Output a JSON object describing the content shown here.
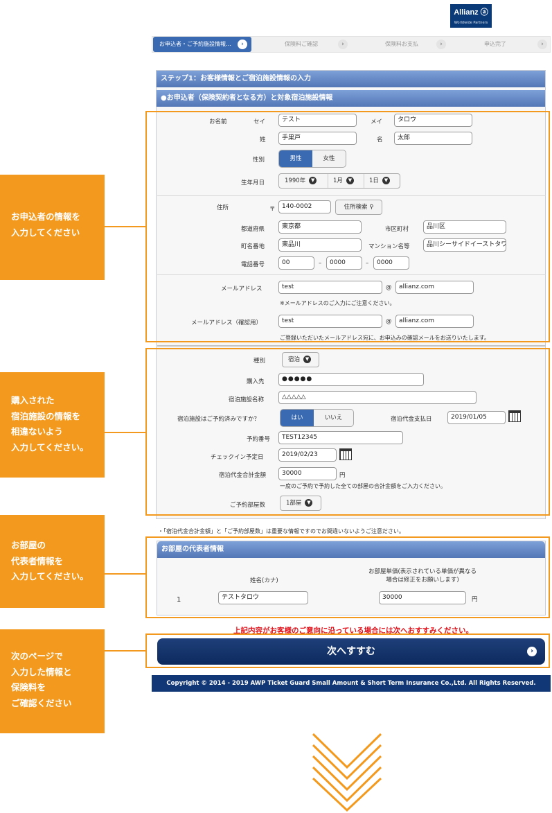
{
  "logo": {
    "name": "Allianz ⓐ",
    "sub": "Worldwide Partners"
  },
  "steps": [
    "お申込者・ご予約施設情報…",
    "保険料ご確認",
    "保険料お支払",
    "申込完了"
  ],
  "section_title": "ステップ1：お客様情報とご宿泊施設情報の入力",
  "subsection_title": "●お申込者（保険契約者となる方）と対象宿泊施設情報",
  "applicant": {
    "name_label": "お名前",
    "sei_label": "セイ",
    "sei": "テスト",
    "mei_label": "メイ",
    "mei": "タロウ",
    "last_label": "姓",
    "last": "手巣戸",
    "first_label": "名",
    "first": "太郎",
    "gender_label": "性別",
    "gender_male": "男性",
    "gender_female": "女性",
    "dob_label": "生年月日",
    "dob_year": "1990年",
    "dob_month": "1月",
    "dob_day": "1日"
  },
  "address": {
    "label": "住所",
    "zip_mark": "〒",
    "zip": "140-0002",
    "search_btn": "住所検索",
    "pref_label": "都道府県",
    "pref": "東京都",
    "city_label": "市区町村",
    "city": "品川区",
    "town_label": "町名番地",
    "town": "東品川",
    "bldg_label": "マンション名等",
    "bldg": "品川シーサイドイーストタワ",
    "tel_label": "電話番号",
    "tel1": "00",
    "tel_sep": "–",
    "tel2": "0000",
    "tel3": "0000"
  },
  "email": {
    "label": "メールアドレス",
    "local": "test",
    "at": "@",
    "domain": "allianz.com",
    "note": "※メールアドレスのご入力にご注意ください。",
    "confirm_label": "メールアドレス（確認用）",
    "confirm_local": "test",
    "confirm_domain": "allianz.com",
    "confirm_note": "ご登録いただいたメールアドレス宛に、お申込みの確認メールをお送りいたします。"
  },
  "facility": {
    "type_label": "種別",
    "type": "宿泊",
    "vendor_label": "購入先",
    "vendor": "●●●●●",
    "name_label": "宿泊施設名称",
    "name": "△△△△△",
    "reserved_label": "宿泊施設はご予約済みですか？",
    "yes": "はい",
    "no": "いいえ",
    "pay_date_label": "宿泊代金支払日",
    "pay_date": "2019/01/05",
    "booking_label": "予約番号",
    "booking": "TEST12345",
    "checkin_label": "チェックイン予定日",
    "checkin": "2019/02/23",
    "total_label": "宿泊代金合計金額",
    "total": "30000",
    "yen": "円",
    "total_note": "一度のご予約で予約した全ての部屋の合計金額をご入力ください。",
    "rooms_label": "ご予約部屋数",
    "rooms": "1部屋"
  },
  "warning_note": "・「宿泊代金合計金額」と「ご予約部屋数」は重要な情報ですのでお間違いないようご注意ださい。",
  "rep": {
    "title": "お部屋の代表者情報",
    "col_name": "姓名(カナ)",
    "col_price1": "お部屋単価(表示されている単価が異なる",
    "col_price2": "場合は修正をお願いします)",
    "row_no": "1",
    "row_name": "テストタロウ",
    "row_price": "30000",
    "yen": "円"
  },
  "red_notice": "上記内容がお客様のご意向に沿っている場合には次へおすすみください。",
  "next_button": "次へすすむ",
  "footer": "Copyright © 2014 - 2019 AWP Ticket Guard Small Amount & Short Term Insurance Co.,Ltd. All Rights Reserved.",
  "callouts": [
    {
      "l1": "お申込者の情報を",
      "l2": "入力してください"
    },
    {
      "l1": "購入された",
      "l2": "宿泊施設の情報を",
      "l3": "相違ないよう",
      "l4": "入力してください。"
    },
    {
      "l1": "お部屋の",
      "l2": "代表者情報を",
      "l3": "入力してください。"
    },
    {
      "l1": "次のページで",
      "l2": "入力した情報と",
      "l3": "保険料を",
      "l4": "ご確認ください"
    }
  ],
  "colors": {
    "accent": "#f39a1e",
    "brand": "#0a3a78",
    "header": "#5377b6",
    "alert": "#e0111a"
  }
}
